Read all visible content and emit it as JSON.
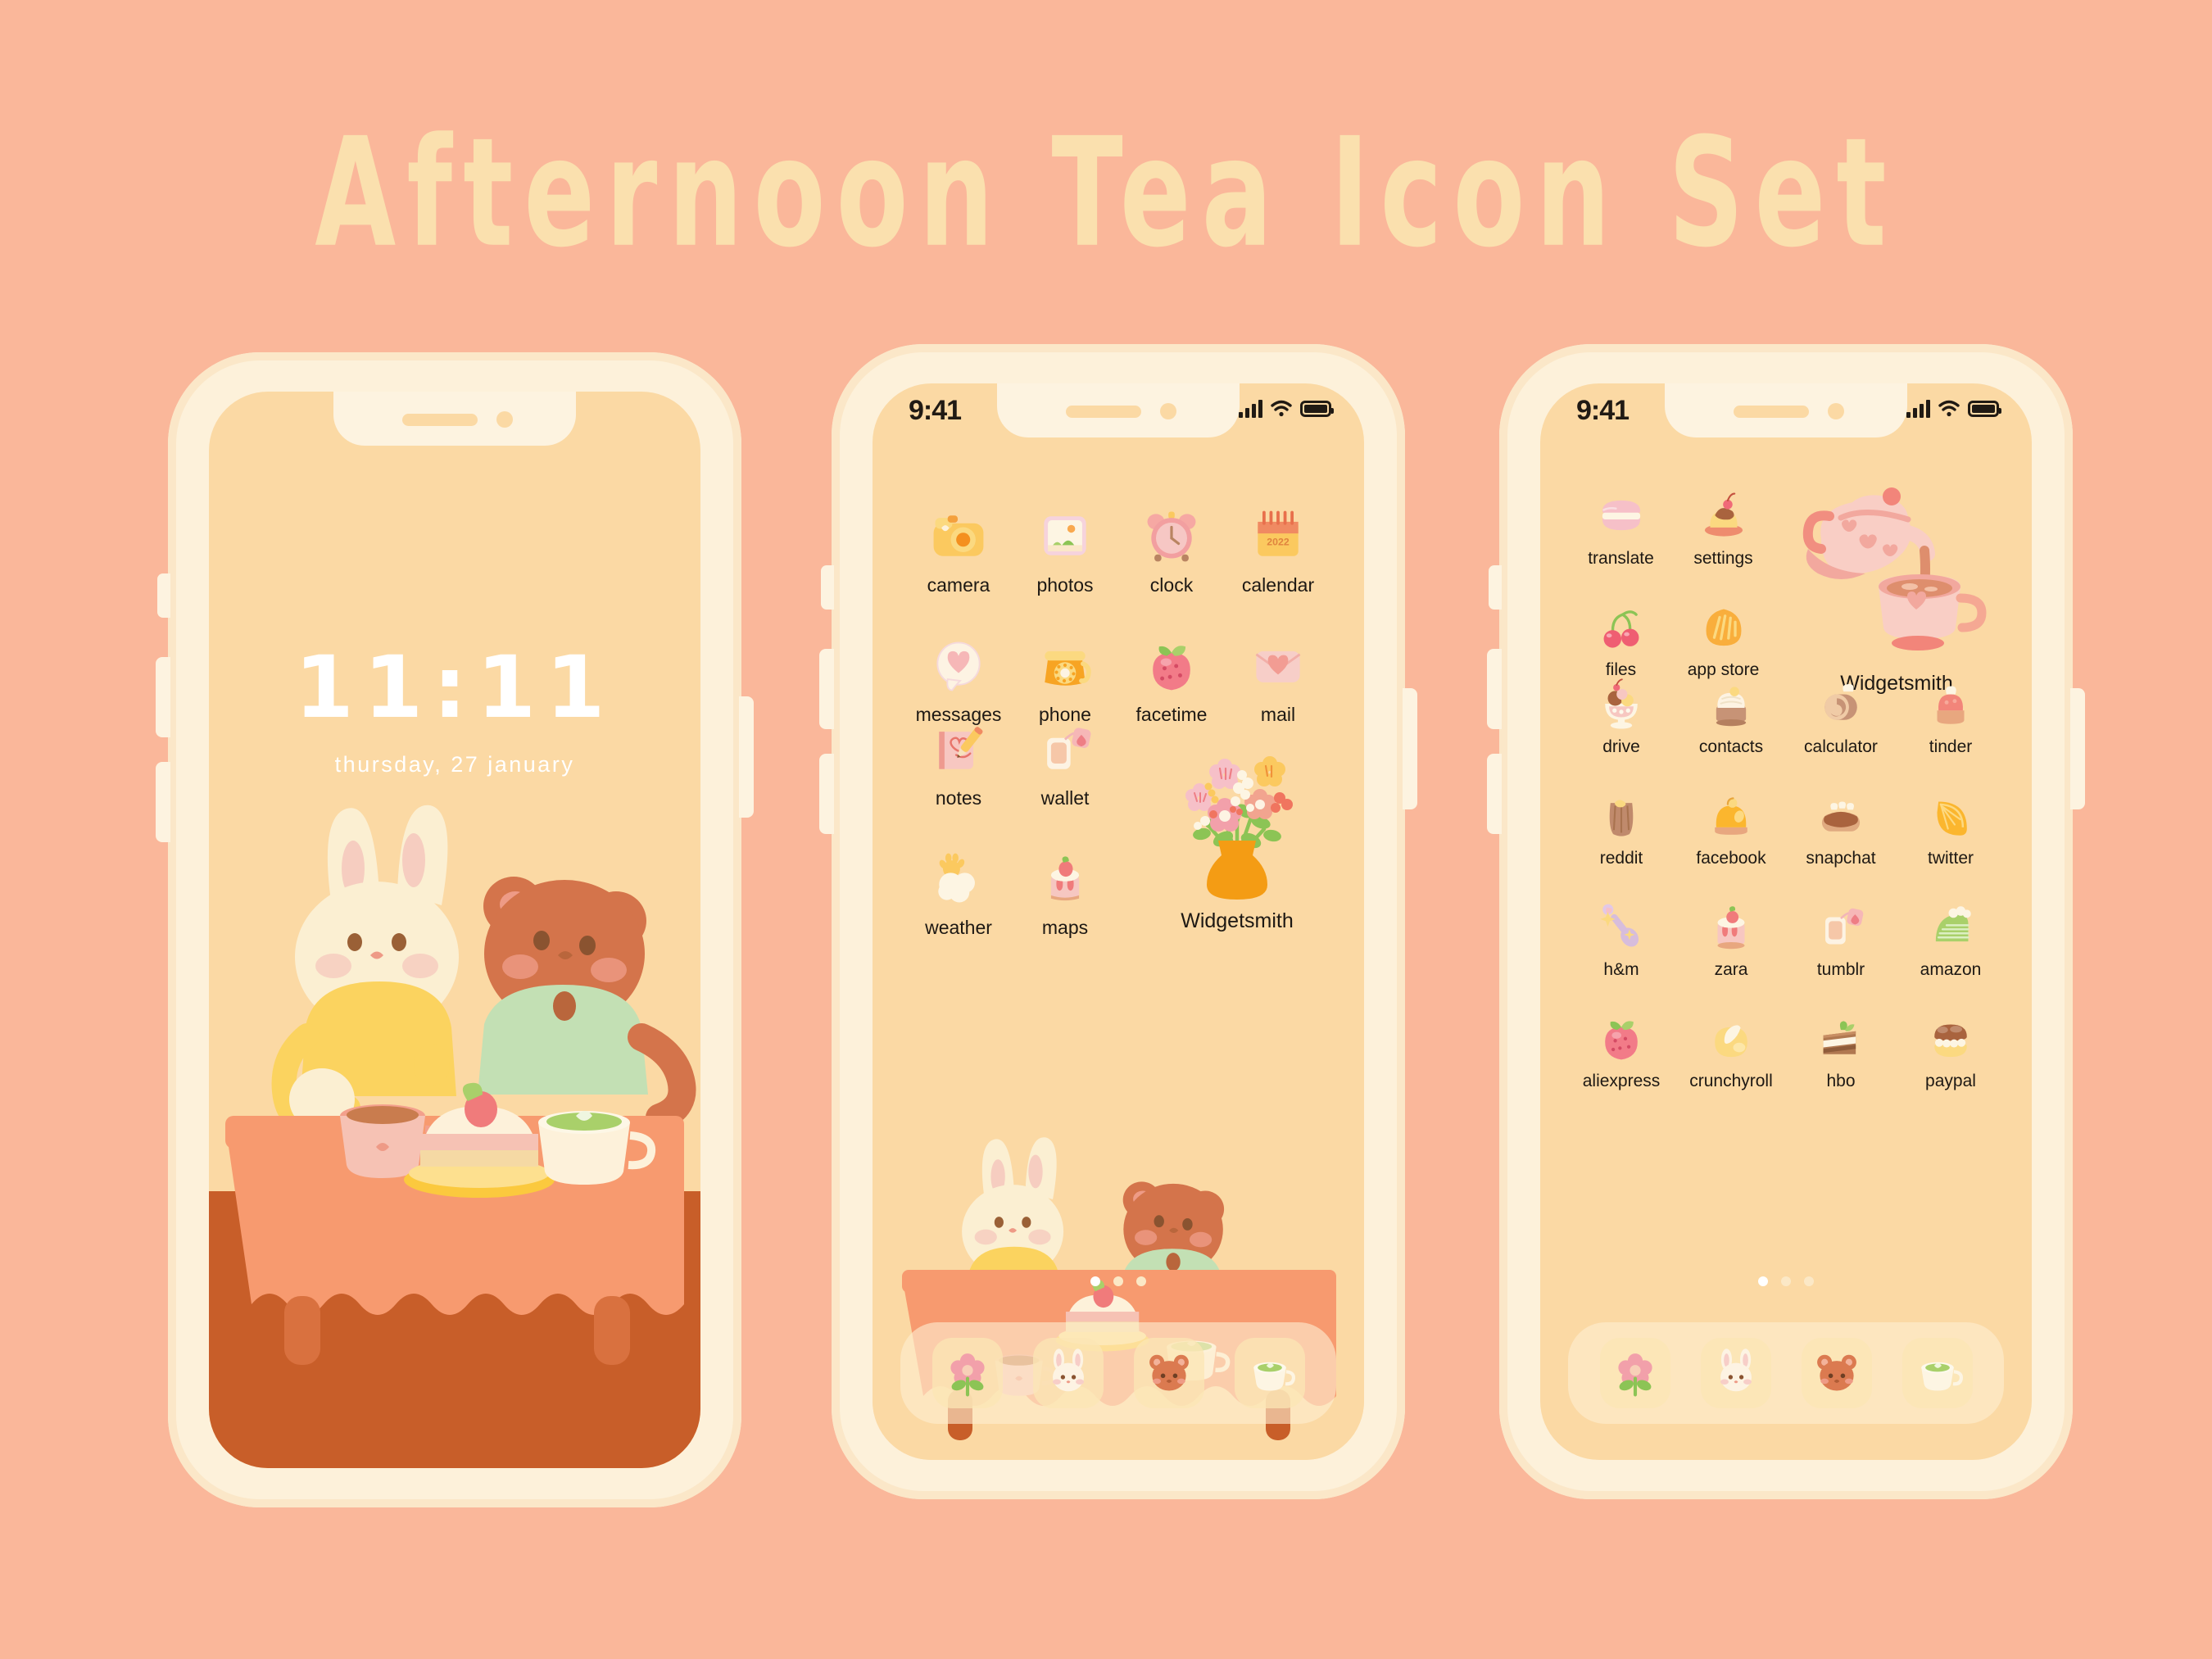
{
  "page": {
    "title": "Afternoon Tea Icon Set",
    "background_color": "#FAB79A",
    "title_color": "#FAE0AE"
  },
  "phone1": {
    "kind": "lock-screen",
    "time": "11:11",
    "date": "thursday, 27 january",
    "wallpaper": "bunny-and-bear-afternoon-tea"
  },
  "phone2": {
    "kind": "home-screen-page-1",
    "status": {
      "time": "9:41",
      "signal": "signal-icon",
      "wifi": "wifi-icon",
      "battery": "battery-icon"
    },
    "apps": [
      {
        "label": "camera",
        "icon": "camera-icon"
      },
      {
        "label": "photos",
        "icon": "photo-frame-icon"
      },
      {
        "label": "clock",
        "icon": "alarm-clock-icon"
      },
      {
        "label": "calendar",
        "icon": "calendar-icon",
        "year": "2022"
      },
      {
        "label": "messages",
        "icon": "speech-bubble-heart-icon"
      },
      {
        "label": "phone",
        "icon": "rotary-phone-icon"
      },
      {
        "label": "facetime",
        "icon": "strawberry-icon"
      },
      {
        "label": "mail",
        "icon": "envelope-heart-icon"
      },
      {
        "label": "notes",
        "icon": "notebook-pencil-icon"
      },
      {
        "label": "wallet",
        "icon": "tea-bag-icon"
      },
      {
        "label": "weather",
        "icon": "sun-cloud-icon"
      },
      {
        "label": "maps",
        "icon": "strawberry-shortcake-icon"
      }
    ],
    "widget": {
      "label": "Widgetsmith",
      "icon": "flower-vase-icon"
    },
    "page_dots": {
      "count": 3,
      "active": 1
    },
    "dock": [
      {
        "icon": "flower-icon"
      },
      {
        "icon": "bunny-face-icon"
      },
      {
        "icon": "bear-face-icon"
      },
      {
        "icon": "matcha-latte-icon"
      }
    ]
  },
  "phone3": {
    "kind": "home-screen-page-2",
    "status": {
      "time": "9:41",
      "signal": "signal-icon",
      "wifi": "wifi-icon",
      "battery": "battery-icon"
    },
    "apps": [
      {
        "label": "translate",
        "icon": "macaron-icon"
      },
      {
        "label": "settings",
        "icon": "pudding-cherry-icon"
      },
      {
        "label": "files",
        "icon": "cherries-icon"
      },
      {
        "label": "app store",
        "icon": "madeleine-icon"
      },
      {
        "label": "drive",
        "icon": "parfait-glass-icon"
      },
      {
        "label": "contacts",
        "icon": "cream-cake-icon"
      },
      {
        "label": "calculator",
        "icon": "swiss-roll-icon"
      },
      {
        "label": "tinder",
        "icon": "mousse-cake-icon"
      },
      {
        "label": "reddit",
        "icon": "flan-pudding-icon"
      },
      {
        "label": "facebook",
        "icon": "orange-dome-cake-icon"
      },
      {
        "label": "snapchat",
        "icon": "eclair-icon"
      },
      {
        "label": "twitter",
        "icon": "orange-slice-icon"
      },
      {
        "label": "h&m",
        "icon": "sparkle-spoon-icon"
      },
      {
        "label": "zara",
        "icon": "strawberry-cake-icon"
      },
      {
        "label": "tumblr",
        "icon": "tea-bag-icon"
      },
      {
        "label": "amazon",
        "icon": "matcha-layer-cake-icon"
      },
      {
        "label": "aliexpress",
        "icon": "strawberry-icon"
      },
      {
        "label": "crunchyroll",
        "icon": "custard-pudding-icon"
      },
      {
        "label": "hbo",
        "icon": "layer-cake-slice-icon"
      },
      {
        "label": "paypal",
        "icon": "cream-bun-icon"
      }
    ],
    "widget": {
      "label": "Widgetsmith",
      "icon": "teapot-pouring-icon"
    },
    "page_dots": {
      "count": 3,
      "active": 1
    },
    "dock": [
      {
        "icon": "flower-icon"
      },
      {
        "icon": "bunny-face-icon"
      },
      {
        "icon": "bear-face-icon"
      },
      {
        "icon": "matcha-latte-icon"
      }
    ]
  },
  "colors": {
    "background": "#FAB79A",
    "phone_frame": "#FDF1DA",
    "screen": "#FBD9A4",
    "title": "#FAE0AE",
    "tablecloth": "#F79A6F",
    "floor": "#C85E29",
    "bunny": "#FBEFD2",
    "bear": "#D4744B",
    "matcha": "#A9D06A"
  }
}
